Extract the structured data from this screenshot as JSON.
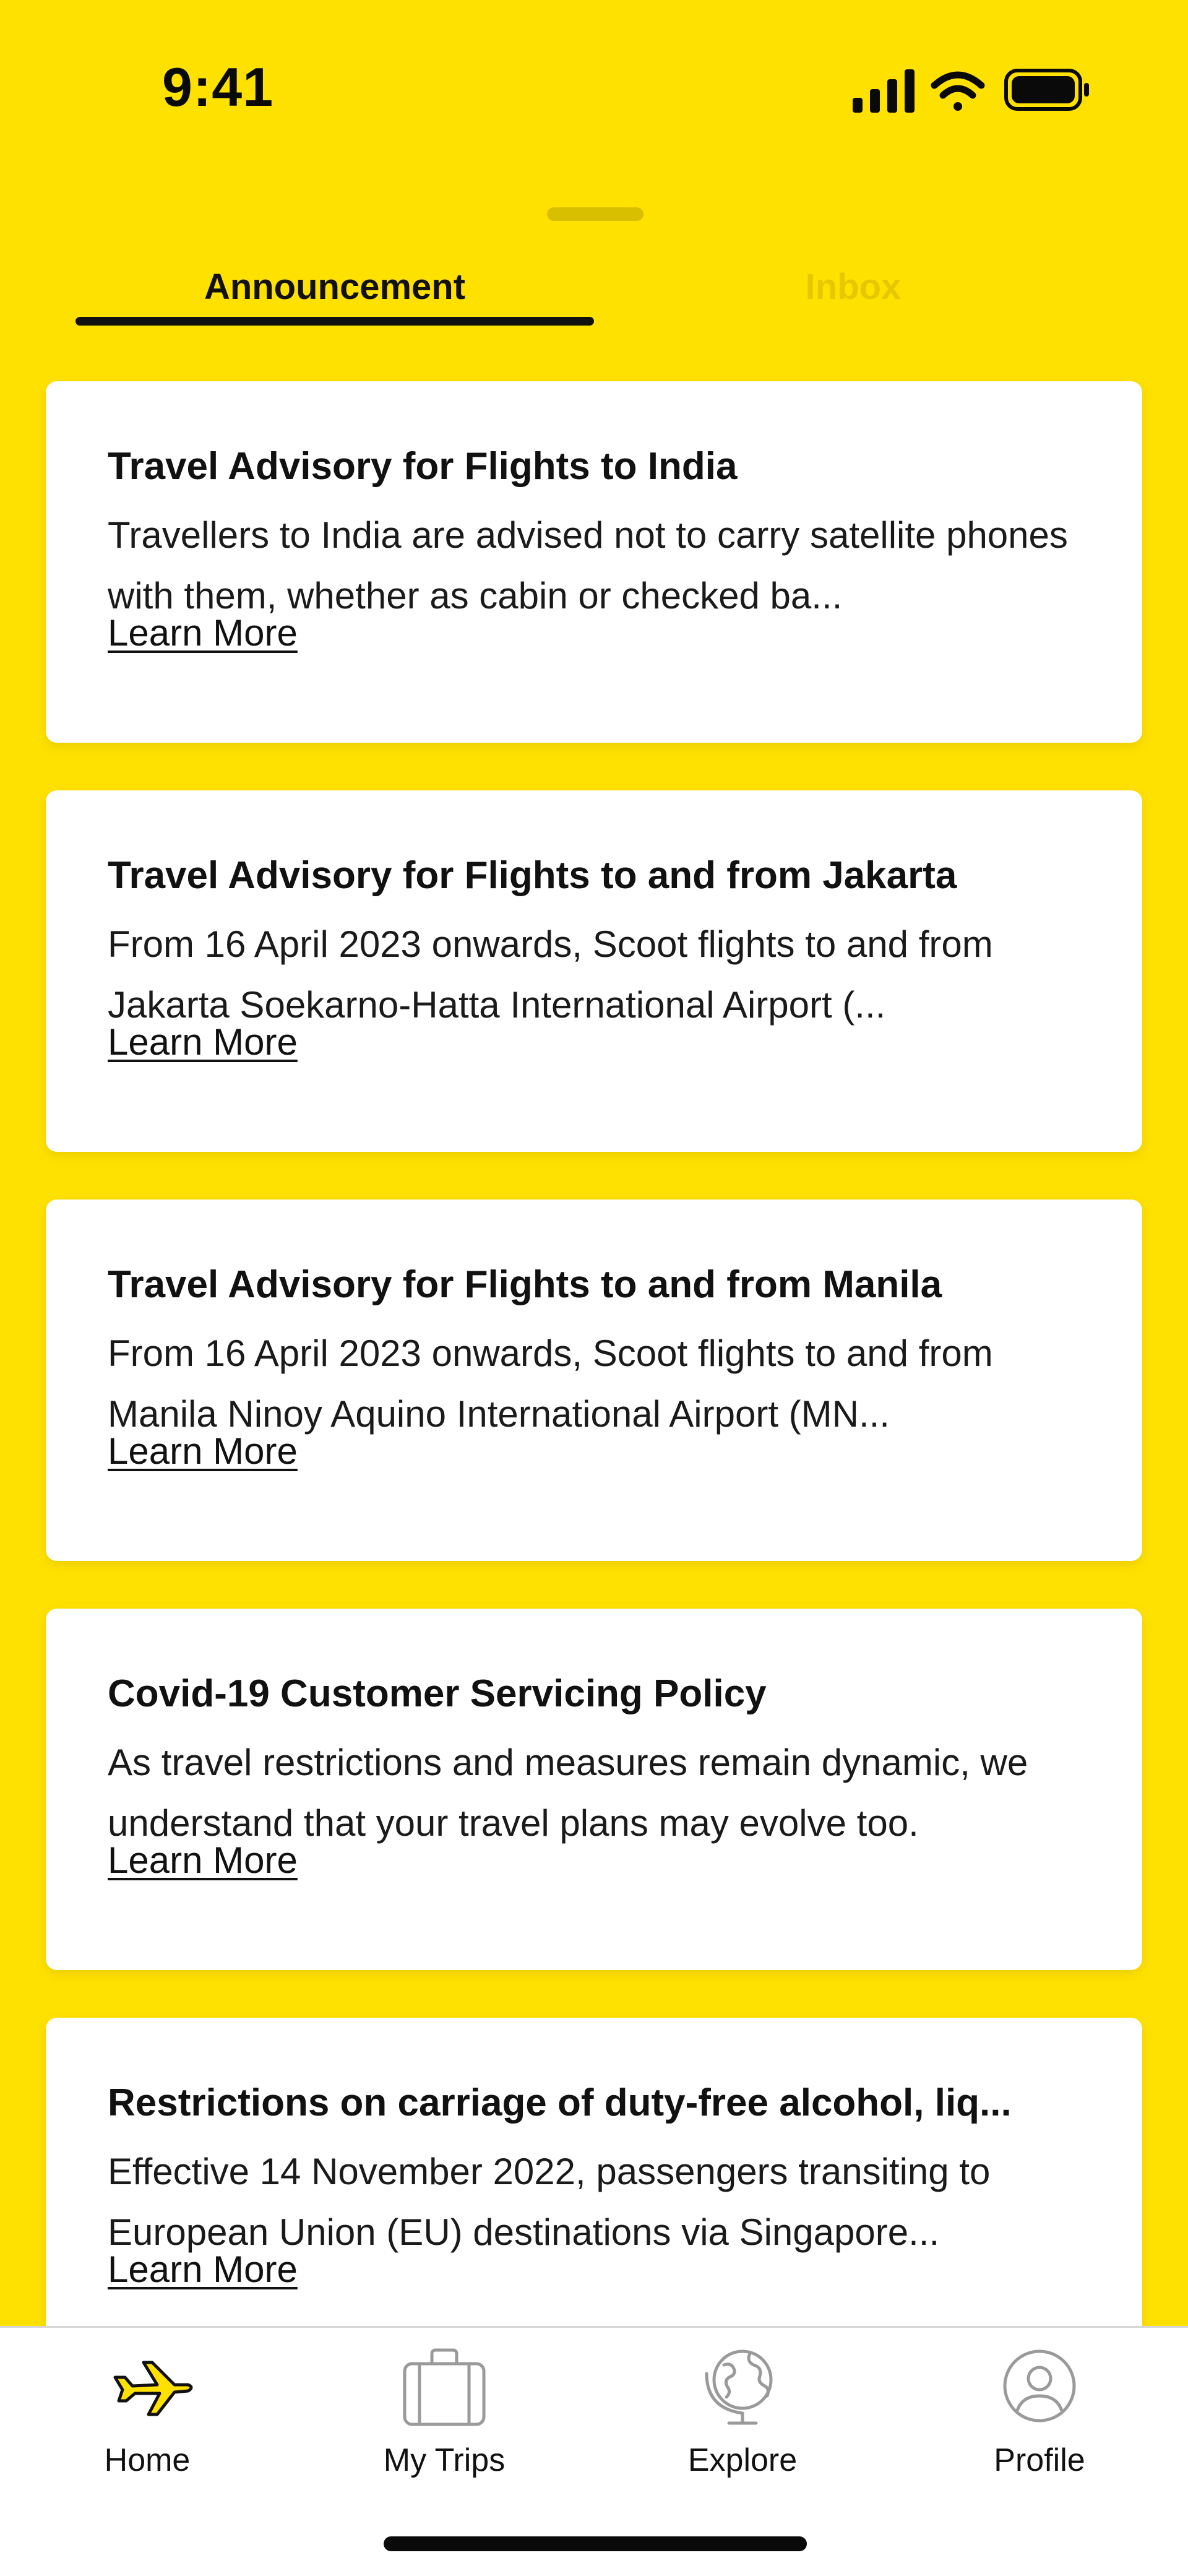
{
  "status_bar": {
    "time": "9:41"
  },
  "tabs": [
    {
      "label": "Announcement",
      "active": true
    },
    {
      "label": "Inbox",
      "active": false
    }
  ],
  "announcements": [
    {
      "title": "Travel Advisory for Flights to India",
      "description": "Travellers to India are advised not to carry satellite phones with them, whether as cabin or checked ba...",
      "link": "Learn More"
    },
    {
      "title": "Travel Advisory for Flights to and from Jakarta",
      "description": "From 16 April 2023 onwards, Scoot flights to and from Jakarta Soekarno-Hatta International Airport (...",
      "link": "Learn More"
    },
    {
      "title": "Travel Advisory for Flights to and from Manila",
      "description": "From 16 April 2023 onwards, Scoot flights to and from Manila Ninoy Aquino International Airport (MN...",
      "link": "Learn More"
    },
    {
      "title": "Covid-19 Customer Servicing Policy",
      "description": "As travel restrictions and measures remain dynamic, we understand that your travel plans may evolve too.",
      "link": "Learn More"
    },
    {
      "title": "Restrictions on carriage of duty-free alcohol, liq...",
      "description": "Effective 14 November 2022, passengers transiting to European Union (EU) destinations via Singapore...",
      "link": "Learn More"
    }
  ],
  "bottom_nav": [
    {
      "label": "Home",
      "icon": "airplane-icon",
      "active": true
    },
    {
      "label": "My Trips",
      "icon": "suitcase-icon",
      "active": false
    },
    {
      "label": "Explore",
      "icon": "globe-icon",
      "active": false
    },
    {
      "label": "Profile",
      "icon": "user-icon",
      "active": false
    }
  ],
  "colors": {
    "brand_yellow": "#FFE100",
    "text": "#111111",
    "inactive_tab": "#E6C800",
    "card": "#FFFFFF"
  }
}
